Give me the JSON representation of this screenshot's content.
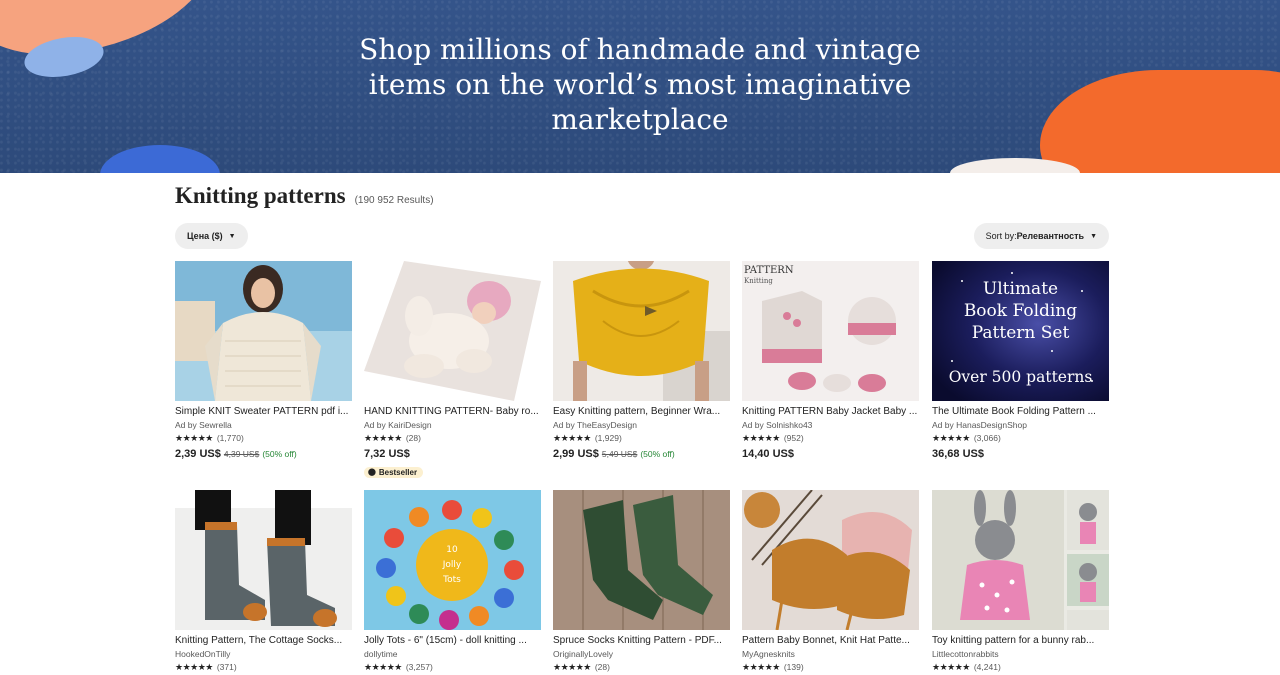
{
  "hero": {
    "title": "Shop millions of handmade and vintage items on the world’s most imaginative marketplace"
  },
  "results": {
    "title": "Knitting patterns",
    "count": "(190 952 Results)"
  },
  "filters": {
    "price_label": "Цена ($)",
    "sort_prefix": "Sort by: ",
    "sort_value": "Релевантность"
  },
  "icons": {
    "caret": "caret-down-icon",
    "star": "star-icon",
    "bestseller": "medal-icon"
  },
  "colors": {
    "hero_bg": "#2f4e7f",
    "discount": "#258635",
    "badge_bg": "#fcf0d0"
  },
  "listings": [
    {
      "title": "Simple KNIT Sweater PATTERN pdf i...",
      "shop": "Ad by Sewrella",
      "stars": "★★★★★",
      "rating": 5,
      "reviews": "(1,770)",
      "price": "2,39 US$",
      "old_price": "4,39 US$",
      "discount": "(50% off)",
      "badge": ""
    },
    {
      "title": "HAND KNITTING PATTERN- Baby ro...",
      "shop": "Ad by KairiDesign",
      "stars": "★★★★★",
      "rating": 4.5,
      "reviews": "(28)",
      "price": "7,32 US$",
      "old_price": "",
      "discount": "",
      "badge": "Bestseller"
    },
    {
      "title": "Easy Knitting pattern, Beginner Wra...",
      "shop": "Ad by TheEasyDesign",
      "stars": "★★★★★",
      "rating": 5,
      "reviews": "(1,929)",
      "price": "2,99 US$",
      "old_price": "5,49 US$",
      "discount": "(50% off)",
      "badge": ""
    },
    {
      "title": "Knitting PATTERN Baby Jacket Baby ...",
      "shop": "Ad by Solnishko43",
      "stars": "★★★★★",
      "rating": 5,
      "reviews": "(952)",
      "price": "14,40 US$",
      "old_price": "",
      "discount": "",
      "badge": "",
      "image_text_top": "PATTERN",
      "image_text_sub": "Knitting"
    },
    {
      "title": "The Ultimate Book Folding Pattern ...",
      "shop": "Ad by HanasDesignShop",
      "stars": "★★★★★",
      "rating": 4.5,
      "reviews": "(3,066)",
      "price": "36,68 US$",
      "old_price": "",
      "discount": "",
      "badge": "",
      "image_lines": [
        "Ultimate",
        "Book Folding",
        "Pattern Set"
      ],
      "image_bottom": "Over 500 patterns"
    },
    {
      "title": "Knitting Pattern, The Cottage Socks...",
      "shop": "HookedOnTilly",
      "stars": "★★★★★",
      "rating": 5,
      "reviews": "(371)"
    },
    {
      "title": "Jolly Tots - 6\" (15cm) - doll knitting ...",
      "shop": "dollytime",
      "stars": "★★★★★",
      "rating": 5,
      "reviews": "(3,257)",
      "image_text": [
        "10",
        "Jolly",
        "Tots"
      ]
    },
    {
      "title": "Spruce Socks Knitting Pattern - PDF...",
      "shop": "OriginallyLovely",
      "stars": "★★★★★",
      "rating": 5,
      "reviews": "(28)"
    },
    {
      "title": "Pattern Baby Bonnet, Knit Hat Patte...",
      "shop": "MyAgnesknits",
      "stars": "★★★★★",
      "rating": 5,
      "reviews": "(139)"
    },
    {
      "title": "Toy knitting pattern for a bunny rab...",
      "shop": "Littlecottonrabbits",
      "stars": "★★★★★",
      "rating": 5,
      "reviews": "(4,241)"
    }
  ]
}
